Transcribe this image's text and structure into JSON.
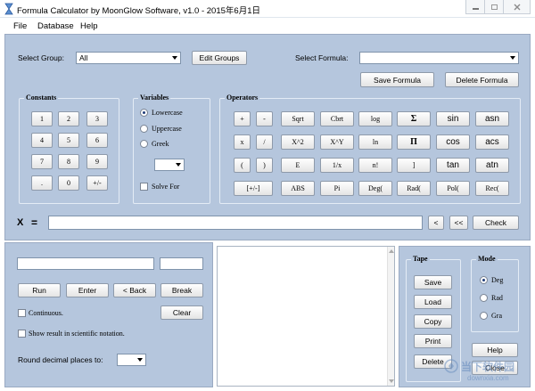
{
  "window": {
    "title": "Formula Calculator by MoonGlow Software, v1.0 - 2015年6月1日"
  },
  "menu": [
    "File",
    "Database",
    "Help"
  ],
  "top": {
    "select_group_label": "Select Group:",
    "group_value": "All",
    "edit_groups": "Edit Groups",
    "select_formula_label": "Select Formula:",
    "formula_value": "",
    "save_formula": "Save Formula",
    "delete_formula": "Delete Formula"
  },
  "constants": {
    "title": "Constants",
    "buttons": [
      "1",
      "2",
      "3",
      "4",
      "5",
      "6",
      "7",
      "8",
      "9",
      ".",
      "0",
      "+/-"
    ]
  },
  "variables": {
    "title": "Variables",
    "options": [
      "Lowercase",
      "Uppercase",
      "Greek"
    ],
    "selected": "Lowercase",
    "solve_for": "Solve For"
  },
  "operators": {
    "title": "Operators",
    "small": [
      "+",
      "-",
      "x",
      "/",
      "(",
      ")",
      "[+/-]"
    ],
    "grid": [
      "Sqrt",
      "Cbrt",
      "log",
      "Σ",
      "sin",
      "asn",
      "X^2",
      "X^Y",
      "ln",
      "Π",
      "cos",
      "acs",
      "E",
      "1/x",
      "n!",
      "]",
      "tan",
      "atn",
      "ABS",
      "Pi",
      "Deg(",
      "Rad(",
      "Pol(",
      "Rec("
    ]
  },
  "expression": {
    "label": "X",
    "equals": "=",
    "value": "",
    "back": "<",
    "back_all": "<<",
    "check": "Check"
  },
  "bottom_left": {
    "run": "Run",
    "enter": "Enter",
    "back": "< Back",
    "break": "Break",
    "continuous": "Continuous.",
    "clear": "Clear",
    "scientific": "Show result in scientific notation.",
    "round_label": "Round decimal places to:"
  },
  "tape": {
    "title": "Tape",
    "buttons": [
      "Save",
      "Load",
      "Copy",
      "Print",
      "Delete"
    ]
  },
  "mode": {
    "title": "Mode",
    "options": [
      "Deg",
      "Rad",
      "Gra"
    ],
    "selected": "Deg"
  },
  "help": "Help",
  "close": "Close",
  "watermark": {
    "site": "当下软件园",
    "url": "downxia.com"
  }
}
